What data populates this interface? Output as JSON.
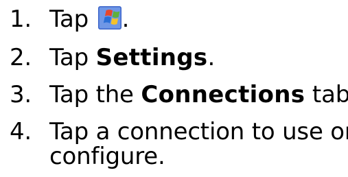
{
  "steps": [
    {
      "number": "1.",
      "text_before": "Tap ",
      "icon": "windows-start-icon",
      "text_after": "."
    },
    {
      "number": "2.",
      "text_before": "Tap ",
      "bold": "Settings",
      "text_after": "."
    },
    {
      "number": "3.",
      "text_before": "Tap the ",
      "bold": "Connections",
      "text_after": " tab."
    },
    {
      "number": "4.",
      "line1": "Tap a connection to use or",
      "line2": "configure."
    }
  ],
  "colors": {
    "text": "#000000",
    "icon_red": "#e8472b",
    "icon_green": "#5fb13a",
    "icon_blue": "#2a6fd6",
    "icon_yellow": "#f5c22b",
    "icon_bg": "#3a63c9"
  }
}
